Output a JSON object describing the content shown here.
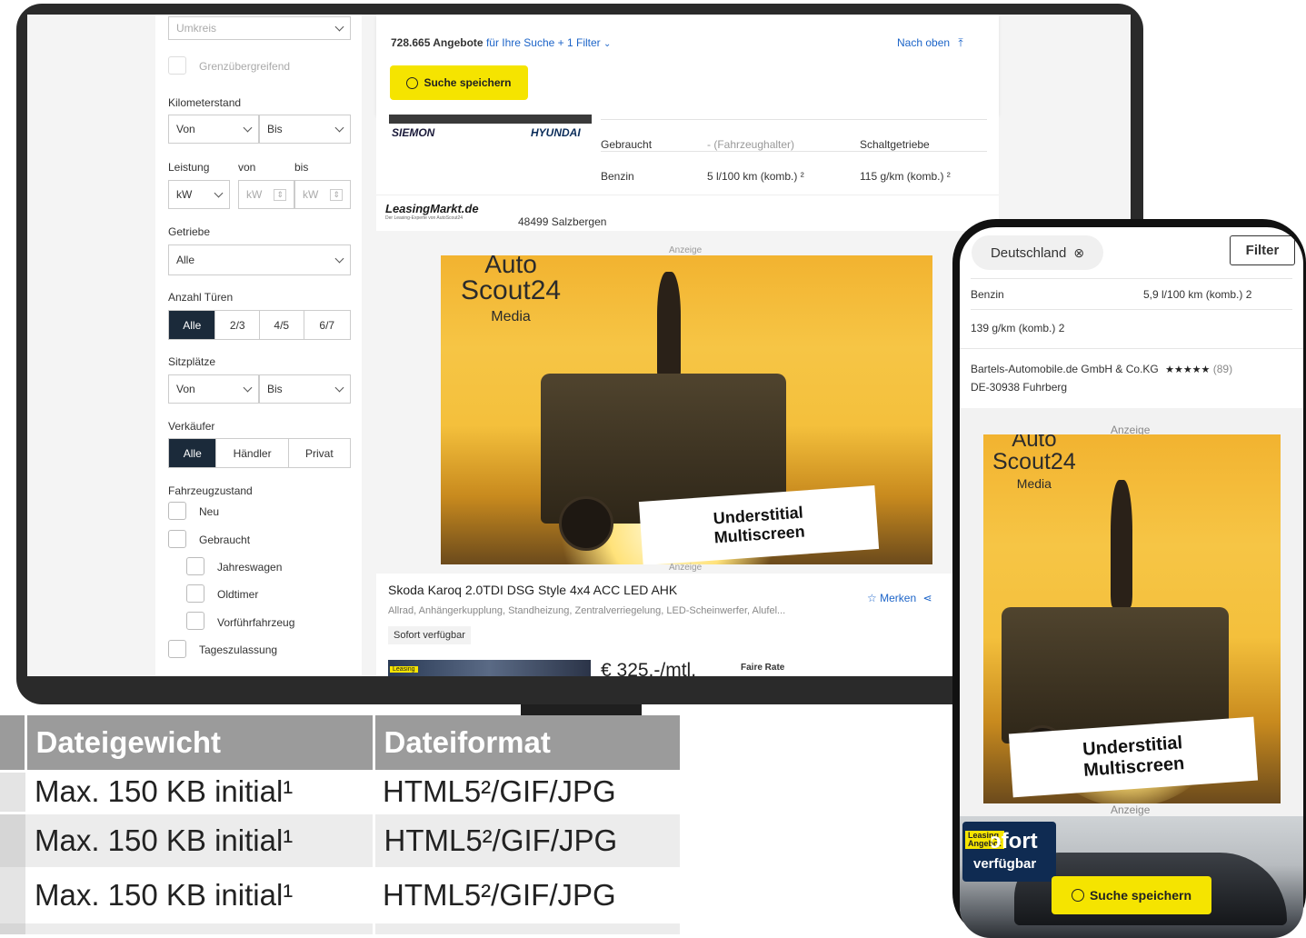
{
  "filters": {
    "umkreis": "Umkreis",
    "grenz": "Grenzübergreifend",
    "km_label": "Kilometerstand",
    "km_from": "Von",
    "km_to": "Bis",
    "leistung_label": "Leistung",
    "leistung_von": "von",
    "leistung_bis": "bis",
    "unit": "kW",
    "getriebe_label": "Getriebe",
    "getriebe_value": "Alle",
    "tueren_label": "Anzahl Türen",
    "tueren_options": [
      "Alle",
      "2/3",
      "4/5",
      "6/7"
    ],
    "sitz_label": "Sitzplätze",
    "sitz_from": "Von",
    "sitz_to": "Bis",
    "verkaeufer_label": "Verkäufer",
    "verkaeufer_options": [
      "Alle",
      "Händler",
      "Privat"
    ],
    "zustand_label": "Fahrzeugzustand",
    "zustand_options": [
      "Neu",
      "Gebraucht",
      "Jahreswagen",
      "Oldtimer",
      "Vorführfahrzeug",
      "Tageszulassung"
    ]
  },
  "results": {
    "count": "728.665 Angebote",
    "for_search": "für Ihre Suche + 1 Filter",
    "nach_oben": "Nach oben",
    "save_search": "Suche speichern"
  },
  "listing1": {
    "dealer_logo": "SIEMON",
    "brand_logo": "HYUNDAI",
    "condition": "Gebraucht",
    "owners": "- (Fahrzeughalter)",
    "gearbox": "Schaltgetriebe",
    "fuel": "Benzin",
    "consumption": "5 l/100 km (komb.) ²",
    "co2": "115 g/km (komb.) ²",
    "seller_logo": "LeasingMarkt.de",
    "seller_sub": "Der Leasing-Experte von AutoScout24",
    "location": "48499 Salzbergen"
  },
  "ad": {
    "label": "Anzeige",
    "brand_line1": "Auto",
    "brand_line2": "Scout24",
    "brand_line3": "Media",
    "caption1": "Understitial",
    "caption2": "Multiscreen"
  },
  "listing2": {
    "title": "Skoda Karoq 2.0TDI DSG Style 4x4 ACC LED AHK",
    "features": "Allrad, Anhängerkupplung, Standheizung, Zentralverriegelung, LED-Scheinwerfer, Alufel...",
    "badge": "Sofort verfügbar",
    "merken": "Merken",
    "price": "€ 325,-/mtl.",
    "rating": "Faire Rate",
    "leasing_tag": "Leasing"
  },
  "phone": {
    "location": "Deutschland",
    "filter": "Filter",
    "fuel": "Benzin",
    "consumption": "5,9 l/100 km (komb.) 2",
    "co2": "139 g/km (komb.) 2",
    "dealer": "Bartels-Automobile.de GmbH & Co.KG",
    "stars": "★★★★★",
    "reviews": "(89)",
    "address": "DE-30938 Fuhrberg",
    "leasing_tag1": "Leasing",
    "leasing_tag2": "Angebot",
    "promo1": "Sofort",
    "promo2": "verfügbar",
    "save_search": "Suche speichern"
  },
  "spec_table": {
    "headers": [
      "Dateigewicht",
      "Dateiformat"
    ],
    "rows": [
      [
        "Max. 150 KB initial¹",
        "HTML5²/GIF/JPG"
      ],
      [
        "Max. 150 KB initial¹",
        "HTML5²/GIF/JPG"
      ],
      [
        "Max. 150 KB initial¹",
        "HTML5²/GIF/JPG"
      ]
    ]
  },
  "colors": {
    "accent_yellow": "#f5e400",
    "link_blue": "#1c64c8",
    "nav_dark": "#1b2a3a",
    "table_header": "#9b9b9b",
    "table_alt": "#ececec"
  }
}
